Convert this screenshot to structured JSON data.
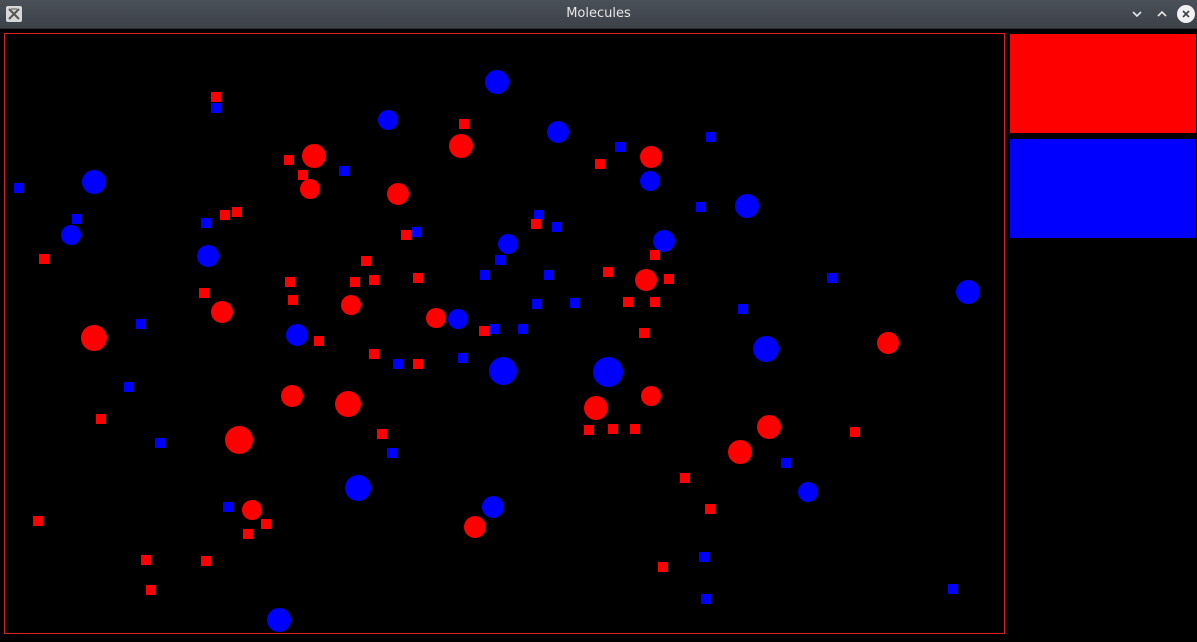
{
  "window": {
    "title": "Molecules",
    "icon": "x-app-icon",
    "controls": [
      "minimize-icon",
      "maximize-icon",
      "close-icon"
    ]
  },
  "colors": {
    "red": "#ff0000",
    "blue": "#0000ff",
    "frame": "#e02020",
    "background": "#000000"
  },
  "legend": [
    {
      "name": "red-species-swatch",
      "color": "#ff0000"
    },
    {
      "name": "blue-species-swatch",
      "color": "#0000ff"
    }
  ]
}
